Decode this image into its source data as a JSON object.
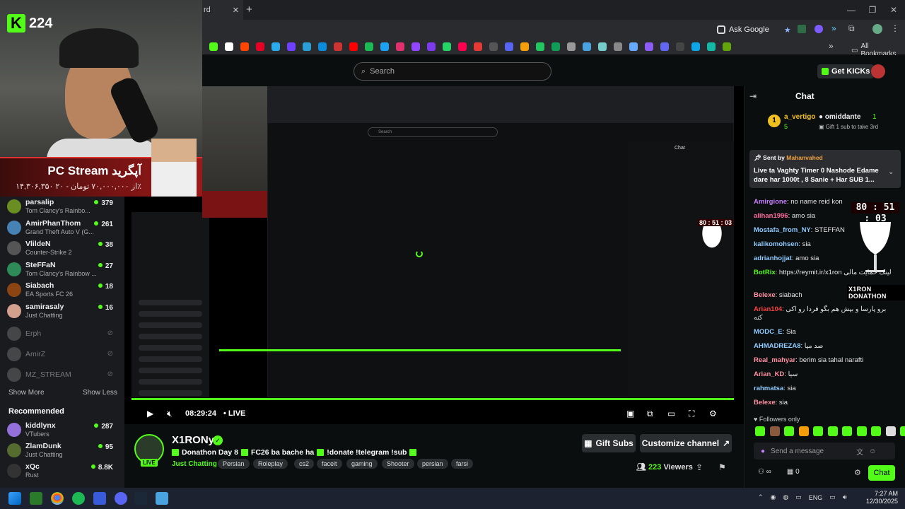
{
  "browser": {
    "tab_label": "rd",
    "new_tab": "+",
    "ask_google": "Ask Google",
    "all_bookmarks": "All Bookmarks",
    "window_controls": [
      "—",
      "❐",
      "✕"
    ]
  },
  "header": {
    "search_placeholder": "Search",
    "get_kicks": "Get KICKs"
  },
  "overlay": {
    "logo_letter": "K",
    "logo_number": "224",
    "banner_title": "PC Stream آپگرید",
    "banner_sub": "۱۴,۳۰۶,۳۵۰ از ۷۰,۰۰۰,۰۰۰ تومان - ۲۰٪",
    "timer": "80 : 51 : 03",
    "goal_label": "X1RON DONATHON"
  },
  "sidebar": {
    "following": [
      {
        "name": "parsalip",
        "game": "Tom Clancy's Rainbo...",
        "viewers": "379",
        "color": "#6b8e23"
      },
      {
        "name": "AmirPhanThom",
        "game": "Grand Theft Auto V (G...",
        "viewers": "261",
        "color": "#4682b4"
      },
      {
        "name": "VlildeN",
        "game": "Counter-Strike 2",
        "viewers": "38",
        "color": "#555555"
      },
      {
        "name": "SteFFaN",
        "game": "Tom Clancy's Rainbow ...",
        "viewers": "27",
        "color": "#2e8b57"
      },
      {
        "name": "Siabach",
        "game": "EA Sports FC 26",
        "viewers": "18",
        "color": "#8b4513"
      },
      {
        "name": "samirasaly",
        "game": "Just Chatting",
        "viewers": "16",
        "color": "#d2a08c"
      }
    ],
    "offline": [
      "Erph",
      "AmirZ",
      "MZ_STREAM"
    ],
    "show_more": "Show More",
    "show_less": "Show Less",
    "recommended_title": "Recommended",
    "recommended": [
      {
        "name": "kiddlynx",
        "game": "VTubers",
        "viewers": "287",
        "color": "#9370db"
      },
      {
        "name": "ZlamDunk",
        "game": "Just Chatting",
        "viewers": "95",
        "color": "#556b2f"
      },
      {
        "name": "xQc",
        "game": "Rust",
        "viewers": "8.8K",
        "color": "#333333"
      }
    ]
  },
  "player": {
    "time": "08:29:24",
    "live": "LIVE"
  },
  "channel": {
    "name": "X1RONy",
    "live_badge": "LIVE",
    "title_parts": [
      "Donathon Day 8",
      "FC26 ba bache ha",
      "!donate !telegram !sub"
    ],
    "category": "Just Chatting",
    "tags": [
      "Persian",
      "Roleplay",
      "cs2",
      "faceit",
      "gaming",
      "Shooter",
      "persian",
      "farsi"
    ],
    "gift_subs": "Gift Subs",
    "customize": "Customize channel",
    "viewers": "223",
    "viewers_label": "Viewers"
  },
  "chat": {
    "title": "Chat",
    "leader1_name": "a_vertigo",
    "leader1_count": "5",
    "leader2_name": "omiddante",
    "leader2_count": "1",
    "leader2_sub": "Gift 1 sub to take 3rd",
    "pinned_by_label": "Sent by",
    "pinned_by": "Mahanvahed",
    "pinned_text": "Live ta Vaghty Timer 0 Nashode Edame dare har 1000t , 8 Sanie + Har SUB 1...",
    "messages": [
      {
        "user": "Amirgione",
        "text": "no name reid kon",
        "color": "#c77dff"
      },
      {
        "user": "alihan1996",
        "text": "amo sia",
        "color": "#ff6b9d"
      },
      {
        "user": "Mostafa_from_NY",
        "text": "STEFFAN",
        "color": "#8ecbff"
      },
      {
        "user": "kalikomohsen",
        "text": "sia",
        "color": "#8ecbff"
      },
      {
        "user": "adrianhojjat",
        "text": "amo sia",
        "color": "#8ecbff"
      },
      {
        "user": "BotRix",
        "text": "https://reymit.ir/x1ron لینک حمایت مالی",
        "color": "#53fc18"
      },
      {
        "user": "Belexe",
        "text": "siabach",
        "color": "#ff8fa3"
      },
      {
        "user": "Arian104",
        "text": "برو پارسا و بپش هم بگو فردا رو اکی کنه",
        "color": "#ff4040"
      },
      {
        "user": "MODC_E",
        "text": "Sia",
        "color": "#8ecbff"
      },
      {
        "user": "AHMADREZA8",
        "text": "صد مپا",
        "color": "#8ecbff"
      },
      {
        "user": "Real_mahyar",
        "text": "berim sia tahal narafti",
        "color": "#ff8fa3"
      },
      {
        "user": "Arian_KD",
        "text": "سیا",
        "color": "#ff8fa3"
      },
      {
        "user": "rahmatsa",
        "text": "sia",
        "color": "#8ecbff"
      },
      {
        "user": "Belexe",
        "text": "sia",
        "color": "#ff8fa3"
      }
    ],
    "followers_only": "Followers only",
    "send_placeholder": "Send a message",
    "chat_button": "Chat",
    "footer_count": "0"
  },
  "taskbar": {
    "lang": "ENG",
    "time": "7:27 AM",
    "date": "12/30/2025"
  },
  "colors": {
    "accent": "#53fc18",
    "bg": "#0b0e0f"
  }
}
